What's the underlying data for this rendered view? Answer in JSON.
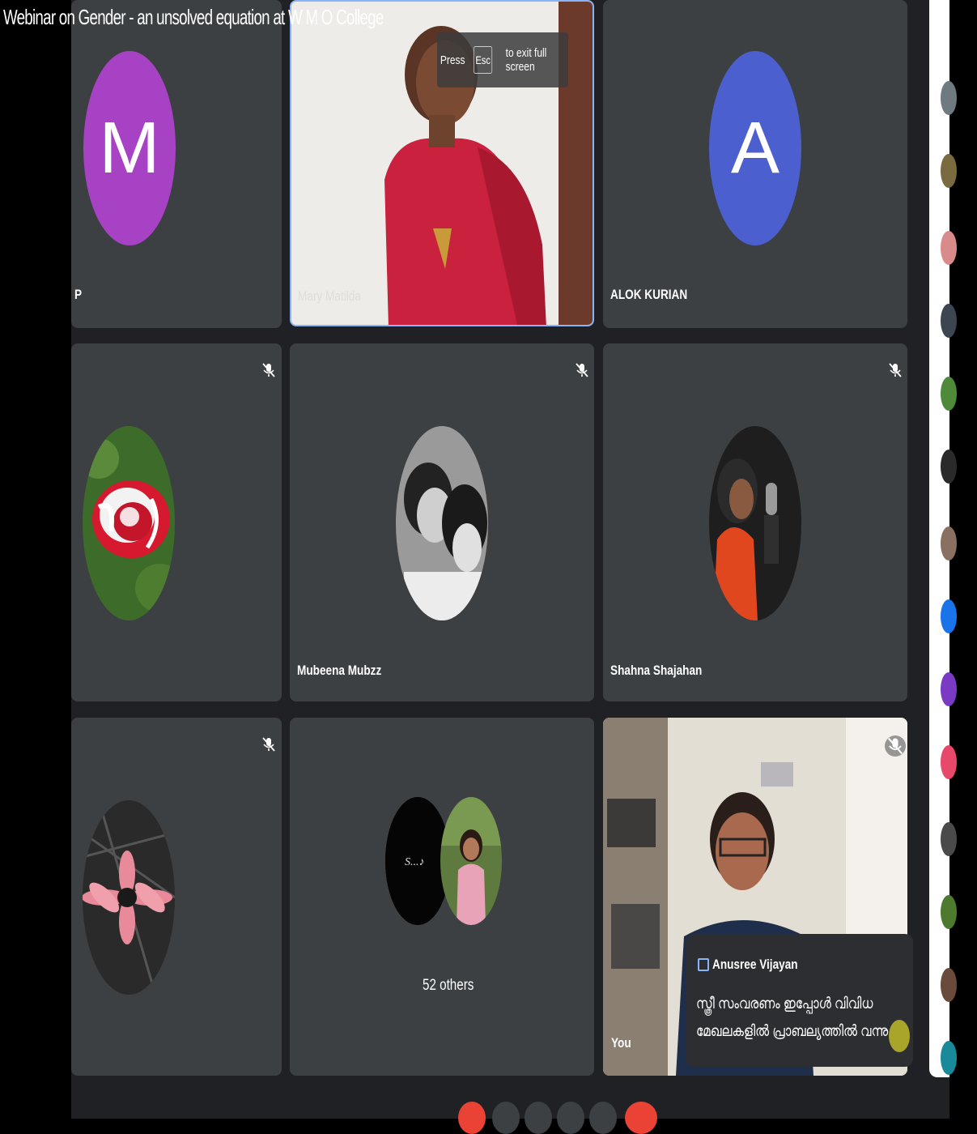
{
  "window": {
    "title": "Webinar on Gender - an unsolved equation at W M O College"
  },
  "fullscreen_hint": {
    "press": "Press",
    "key": "Esc",
    "suffix": "to exit full screen"
  },
  "tiles": [
    {
      "name": "P",
      "avatar_letter": "M",
      "avatar_color": "#a742c4"
    },
    {
      "name": "Mary Matilda",
      "type": "video",
      "active_speaker": true
    },
    {
      "name": "ALOK KURIAN",
      "avatar_letter": "A",
      "avatar_color": "#4c5fcf"
    },
    {
      "name": "",
      "photo": "red-rose-icon",
      "muted": true
    },
    {
      "name": "Mubeena Mubzz",
      "photo": "couple-photo-icon",
      "muted": true
    },
    {
      "name": "Shahna Shajahan",
      "photo": "singer-photo-icon",
      "muted": true
    },
    {
      "name": "",
      "photo": "pink-flower-icon",
      "muted": true
    },
    {
      "name": "52 others",
      "photo": "group-photos-icon"
    },
    {
      "name": "You",
      "type": "video",
      "muted": true
    }
  ],
  "caption": {
    "speaker": "Anusree Vijayan",
    "line1": "സ്ത്രീ സംവരണം ഇപ്പോൾ വിവിധ",
    "line2": "മേഖലകളിൽ പ്രാബല്യത്തിൽ വന്നു ..."
  },
  "colors": {
    "background": "#202124",
    "tile": "#3c4043",
    "active_border": "#8ab4f8",
    "end_call": "#ea4335"
  }
}
